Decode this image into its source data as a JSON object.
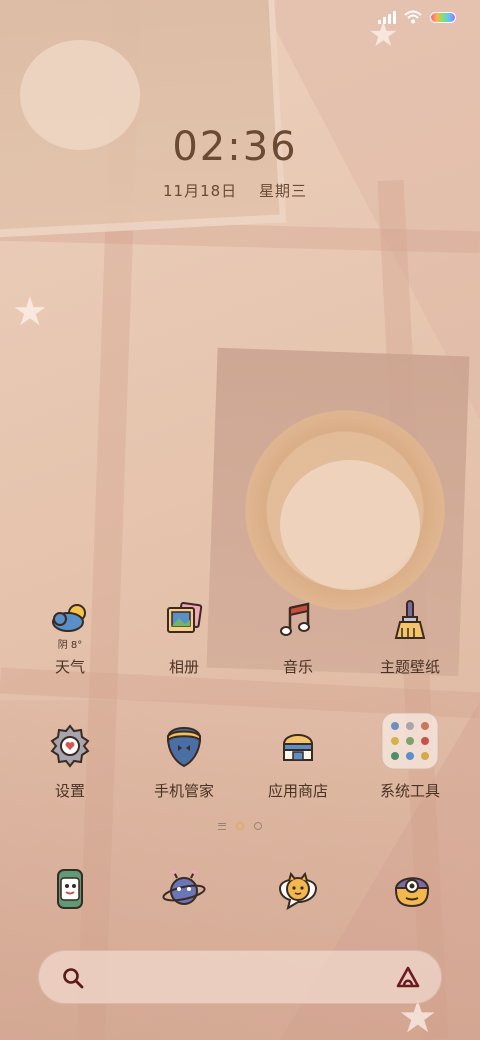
{
  "status_bar": {
    "signal": "signal-icon",
    "wifi": "wifi-icon",
    "battery": "battery-icon"
  },
  "lock_clock": {
    "time": "02:36",
    "date": "11月18日",
    "weekday": "星期三"
  },
  "apps": [
    {
      "label": "天气",
      "icon": "weather-icon",
      "sub": "阴 8°"
    },
    {
      "label": "相册",
      "icon": "gallery-icon"
    },
    {
      "label": "音乐",
      "icon": "music-icon"
    },
    {
      "label": "主题壁纸",
      "icon": "themes-icon"
    },
    {
      "label": "设置",
      "icon": "settings-icon"
    },
    {
      "label": "手机管家",
      "icon": "security-icon"
    },
    {
      "label": "应用商店",
      "icon": "app-store-icon"
    },
    {
      "label": "系统工具",
      "icon": "folder-icon"
    }
  ],
  "page_indicator": {
    "pages": 2,
    "active": 1
  },
  "dock": [
    {
      "icon": "phone-icon"
    },
    {
      "icon": "planet-messages-icon"
    },
    {
      "icon": "cat-chat-icon"
    },
    {
      "icon": "camera-icon"
    }
  ],
  "search": {
    "icon": "search-icon",
    "assistant_icon": "assistant-icon"
  },
  "colors": {
    "text": "#4a3325",
    "clock": "#6b4a34",
    "accent": "#e6a94d"
  }
}
